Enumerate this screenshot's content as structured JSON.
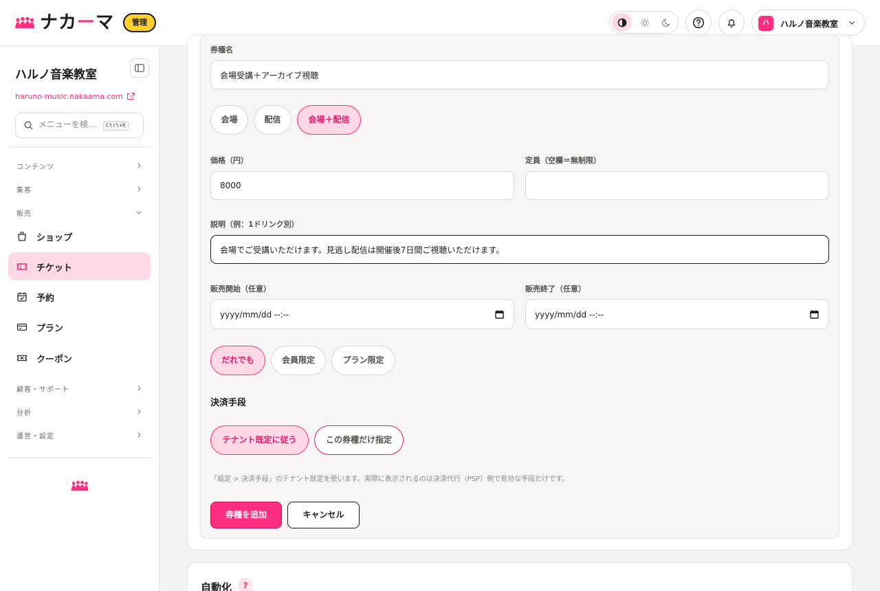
{
  "header": {
    "logo_text_a": "ナカ",
    "logo_text_dash": "ー",
    "logo_text_b": "マ",
    "admin_badge": "管理",
    "tenant_avatar": "ハ",
    "tenant_name": "ハルノ音楽教室",
    "theme_icons": [
      "contrast-icon",
      "sun-icon",
      "moon-icon"
    ],
    "accent_color": "#ff2e7e"
  },
  "sidebar": {
    "title": "ハルノ音楽教室",
    "domain": "haruno-music.nakaama.com",
    "search_placeholder": "メニューを検...",
    "search_shortcut": "Ctrl+K",
    "groups": {
      "contents": "コンテンツ",
      "marketing": "集客",
      "sales": "販売",
      "customer": "顧客・サポート",
      "analytics": "分析",
      "settings": "運営・設定"
    },
    "items": [
      {
        "label": "ショップ",
        "icon": "bag-icon"
      },
      {
        "label": "チケット",
        "icon": "ticket-icon",
        "active": true
      },
      {
        "label": "予約",
        "icon": "calendar-check-icon"
      },
      {
        "label": "プラン",
        "icon": "card-icon"
      },
      {
        "label": "クーポン",
        "icon": "coupon-icon"
      }
    ]
  },
  "form": {
    "ticket_name_label": "券種名",
    "ticket_name_value": "会場受講＋アーカイブ視聴",
    "format_options": [
      "会場",
      "配信",
      "会場＋配信"
    ],
    "format_selected": "会場＋配信",
    "price_label": "価格（円）",
    "price_value": "8000",
    "capacity_label": "定員（空欄＝無制限）",
    "capacity_value": "",
    "description_label": "説明（例：1ドリンク別）",
    "description_value": "会場でご受講いただけます。見逃し配信は開催後7日間ご視聴いただけます。",
    "sale_start_label": "販売開始（任意）",
    "sale_end_label": "販売終了（任意）",
    "date_placeholder": "yyyy/mm/dd --:--",
    "audience_options": [
      "だれでも",
      "会員限定",
      "プラン限定"
    ],
    "audience_selected": "だれでも",
    "payment_heading": "決済手段",
    "payment_options": [
      "テナント既定に従う",
      "この券種だけ指定"
    ],
    "payment_selected": "テナント既定に従う",
    "payment_hint": "「設定 > 決済手段」のテナント既定を使います。実際に表示されるのは決済代行（PSP）側で有効な手段だけです。",
    "submit_label": "券種を追加",
    "cancel_label": "キャンセル"
  },
  "next_section": {
    "title": "自動化",
    "help": "?"
  }
}
